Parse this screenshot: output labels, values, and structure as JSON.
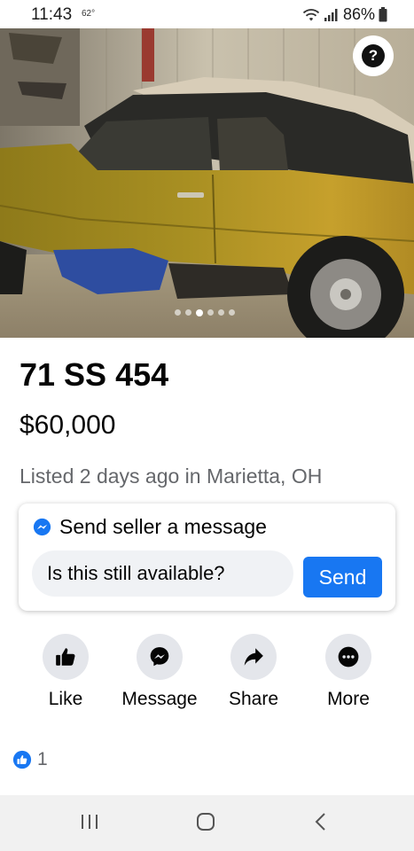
{
  "status_bar": {
    "time": "11:43",
    "temperature": "62°",
    "battery": "86%",
    "icons": [
      "wifi-icon",
      "signal-icon",
      "battery-icon"
    ]
  },
  "photo": {
    "dots_total": 6,
    "dots_active_index": 2,
    "help_label": "?"
  },
  "listing": {
    "title": "71 SS 454",
    "price": "$60,000",
    "listed": "Listed 2 days ago in Marietta, OH"
  },
  "message_card": {
    "header": "Send seller a message",
    "input_value": "Is this still available?",
    "send_label": "Send",
    "accent": "#1877f2"
  },
  "actions": [
    {
      "label": "Like",
      "icon": "thumbs-up-icon"
    },
    {
      "label": "Message",
      "icon": "messenger-icon"
    },
    {
      "label": "Share",
      "icon": "share-arrow-icon"
    },
    {
      "label": "More",
      "icon": "more-dots-icon"
    }
  ],
  "reactions": {
    "count": "1",
    "icon": "like-reaction-icon"
  },
  "nav_bar": {
    "icons": [
      "recent-apps-icon",
      "home-icon",
      "back-icon"
    ]
  }
}
